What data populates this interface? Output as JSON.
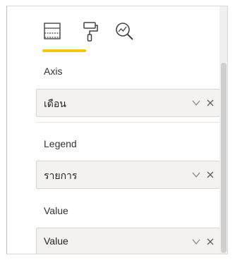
{
  "tabs": [
    {
      "icon": "fields-icon",
      "selected": true
    },
    {
      "icon": "paint-roller-icon",
      "selected": false
    },
    {
      "icon": "analytics-icon",
      "selected": false
    }
  ],
  "accent_color": "#f2c80f",
  "sections": [
    {
      "label": "Axis",
      "field": "เดือน"
    },
    {
      "label": "Legend",
      "field": "รายการ"
    },
    {
      "label": "Value",
      "field": "Value"
    }
  ]
}
